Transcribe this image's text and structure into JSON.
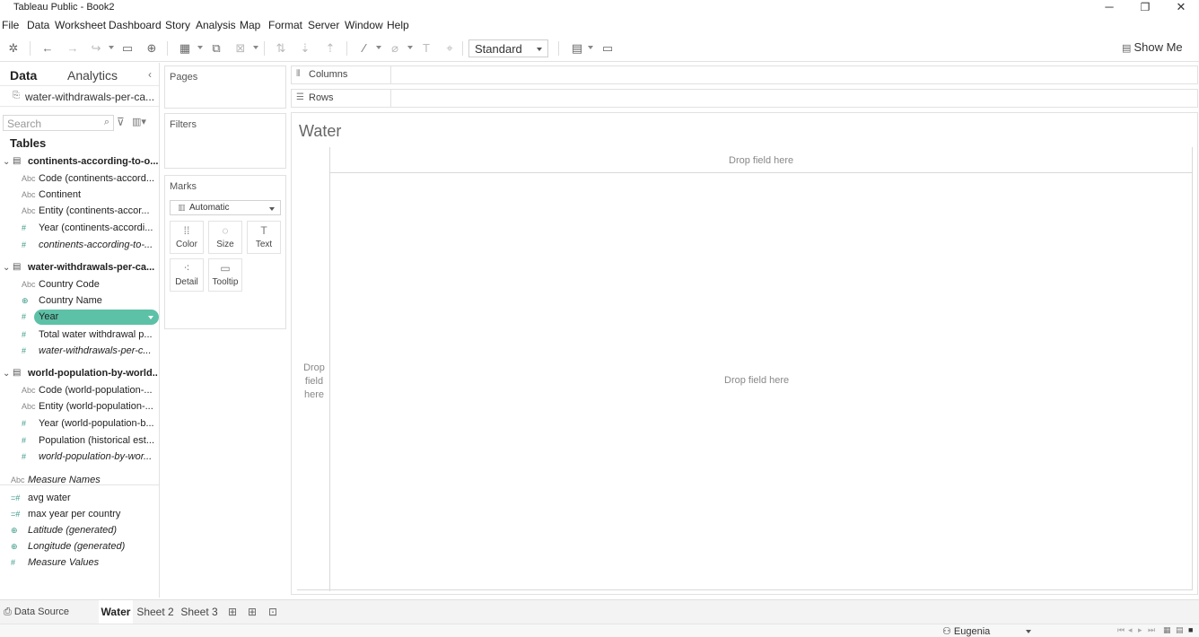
{
  "window": {
    "title": "Tableau Public - Book2",
    "minimize": "─",
    "restore": "❐",
    "close": "✕"
  },
  "menu": [
    "File",
    "Data",
    "Worksheet",
    "Dashboard",
    "Story",
    "Analysis",
    "Map",
    "Format",
    "Server",
    "Window",
    "Help"
  ],
  "toolbar": {
    "fit_value": "Standard",
    "show_me": "Show Me"
  },
  "data_pane": {
    "tab_data": "Data",
    "tab_analytics": "Analytics",
    "datasource": "water-withdrawals-per-ca...",
    "search_placeholder": "Search",
    "tables_header": "Tables",
    "tables": [
      {
        "name": "continents-according-to-o...",
        "fields": [
          {
            "type": "Abc",
            "name": "Code (continents-accord..."
          },
          {
            "type": "Abc",
            "name": "Continent"
          },
          {
            "type": "Abc",
            "name": "Entity (continents-accor..."
          },
          {
            "type": "#",
            "name": "Year (continents-accordi..."
          },
          {
            "type": "#",
            "name": "continents-according-to-..."
          }
        ]
      },
      {
        "name": "water-withdrawals-per-ca...",
        "fields": [
          {
            "type": "Abc",
            "name": "Country Code"
          },
          {
            "type": "⊕",
            "name": "Country Name"
          },
          {
            "type": "#",
            "name": "Year"
          },
          {
            "type": "#",
            "name": "Total water withdrawal p..."
          },
          {
            "type": "#",
            "name": "water-withdrawals-per-c..."
          }
        ]
      },
      {
        "name": "world-population-by-world...",
        "fields": [
          {
            "type": "Abc",
            "name": "Code (world-population-..."
          },
          {
            "type": "Abc",
            "name": "Entity (world-population-..."
          },
          {
            "type": "#",
            "name": "Year (world-population-b..."
          },
          {
            "type": "#",
            "name": "Population (historical est..."
          },
          {
            "type": "#",
            "name": "world-population-by-wor..."
          }
        ]
      }
    ],
    "loose_fields": [
      {
        "type": "Abc",
        "name": "Measure Names"
      },
      {
        "type": "=#",
        "name": "avg water"
      },
      {
        "type": "=#",
        "name": "max year per country"
      },
      {
        "type": "⊕",
        "name": "Latitude (generated)"
      },
      {
        "type": "⊕",
        "name": "Longitude (generated)"
      },
      {
        "type": "#",
        "name": "Measure Values"
      }
    ]
  },
  "cards": {
    "pages": "Pages",
    "filters": "Filters",
    "marks": "Marks",
    "mark_type": "Automatic",
    "buttons": [
      {
        "icon": "⁞⁞",
        "label": "Color"
      },
      {
        "icon": "◌",
        "label": "Size"
      },
      {
        "icon": "T",
        "label": "Text"
      },
      {
        "icon": "⁖",
        "label": "Detail"
      },
      {
        "icon": "▭",
        "label": "Tooltip"
      }
    ]
  },
  "shelves": {
    "columns": "Columns",
    "rows": "Rows"
  },
  "view": {
    "title": "Water",
    "drop_columns": "Drop field here",
    "drop_rows": "Drop field here",
    "drop_main": "Drop field here"
  },
  "sheet_tabs": {
    "datasource": "Data Source",
    "tabs": [
      "Water",
      "Sheet 2",
      "Sheet 3"
    ],
    "active": "Water"
  },
  "status": {
    "user": "Eugenia"
  }
}
